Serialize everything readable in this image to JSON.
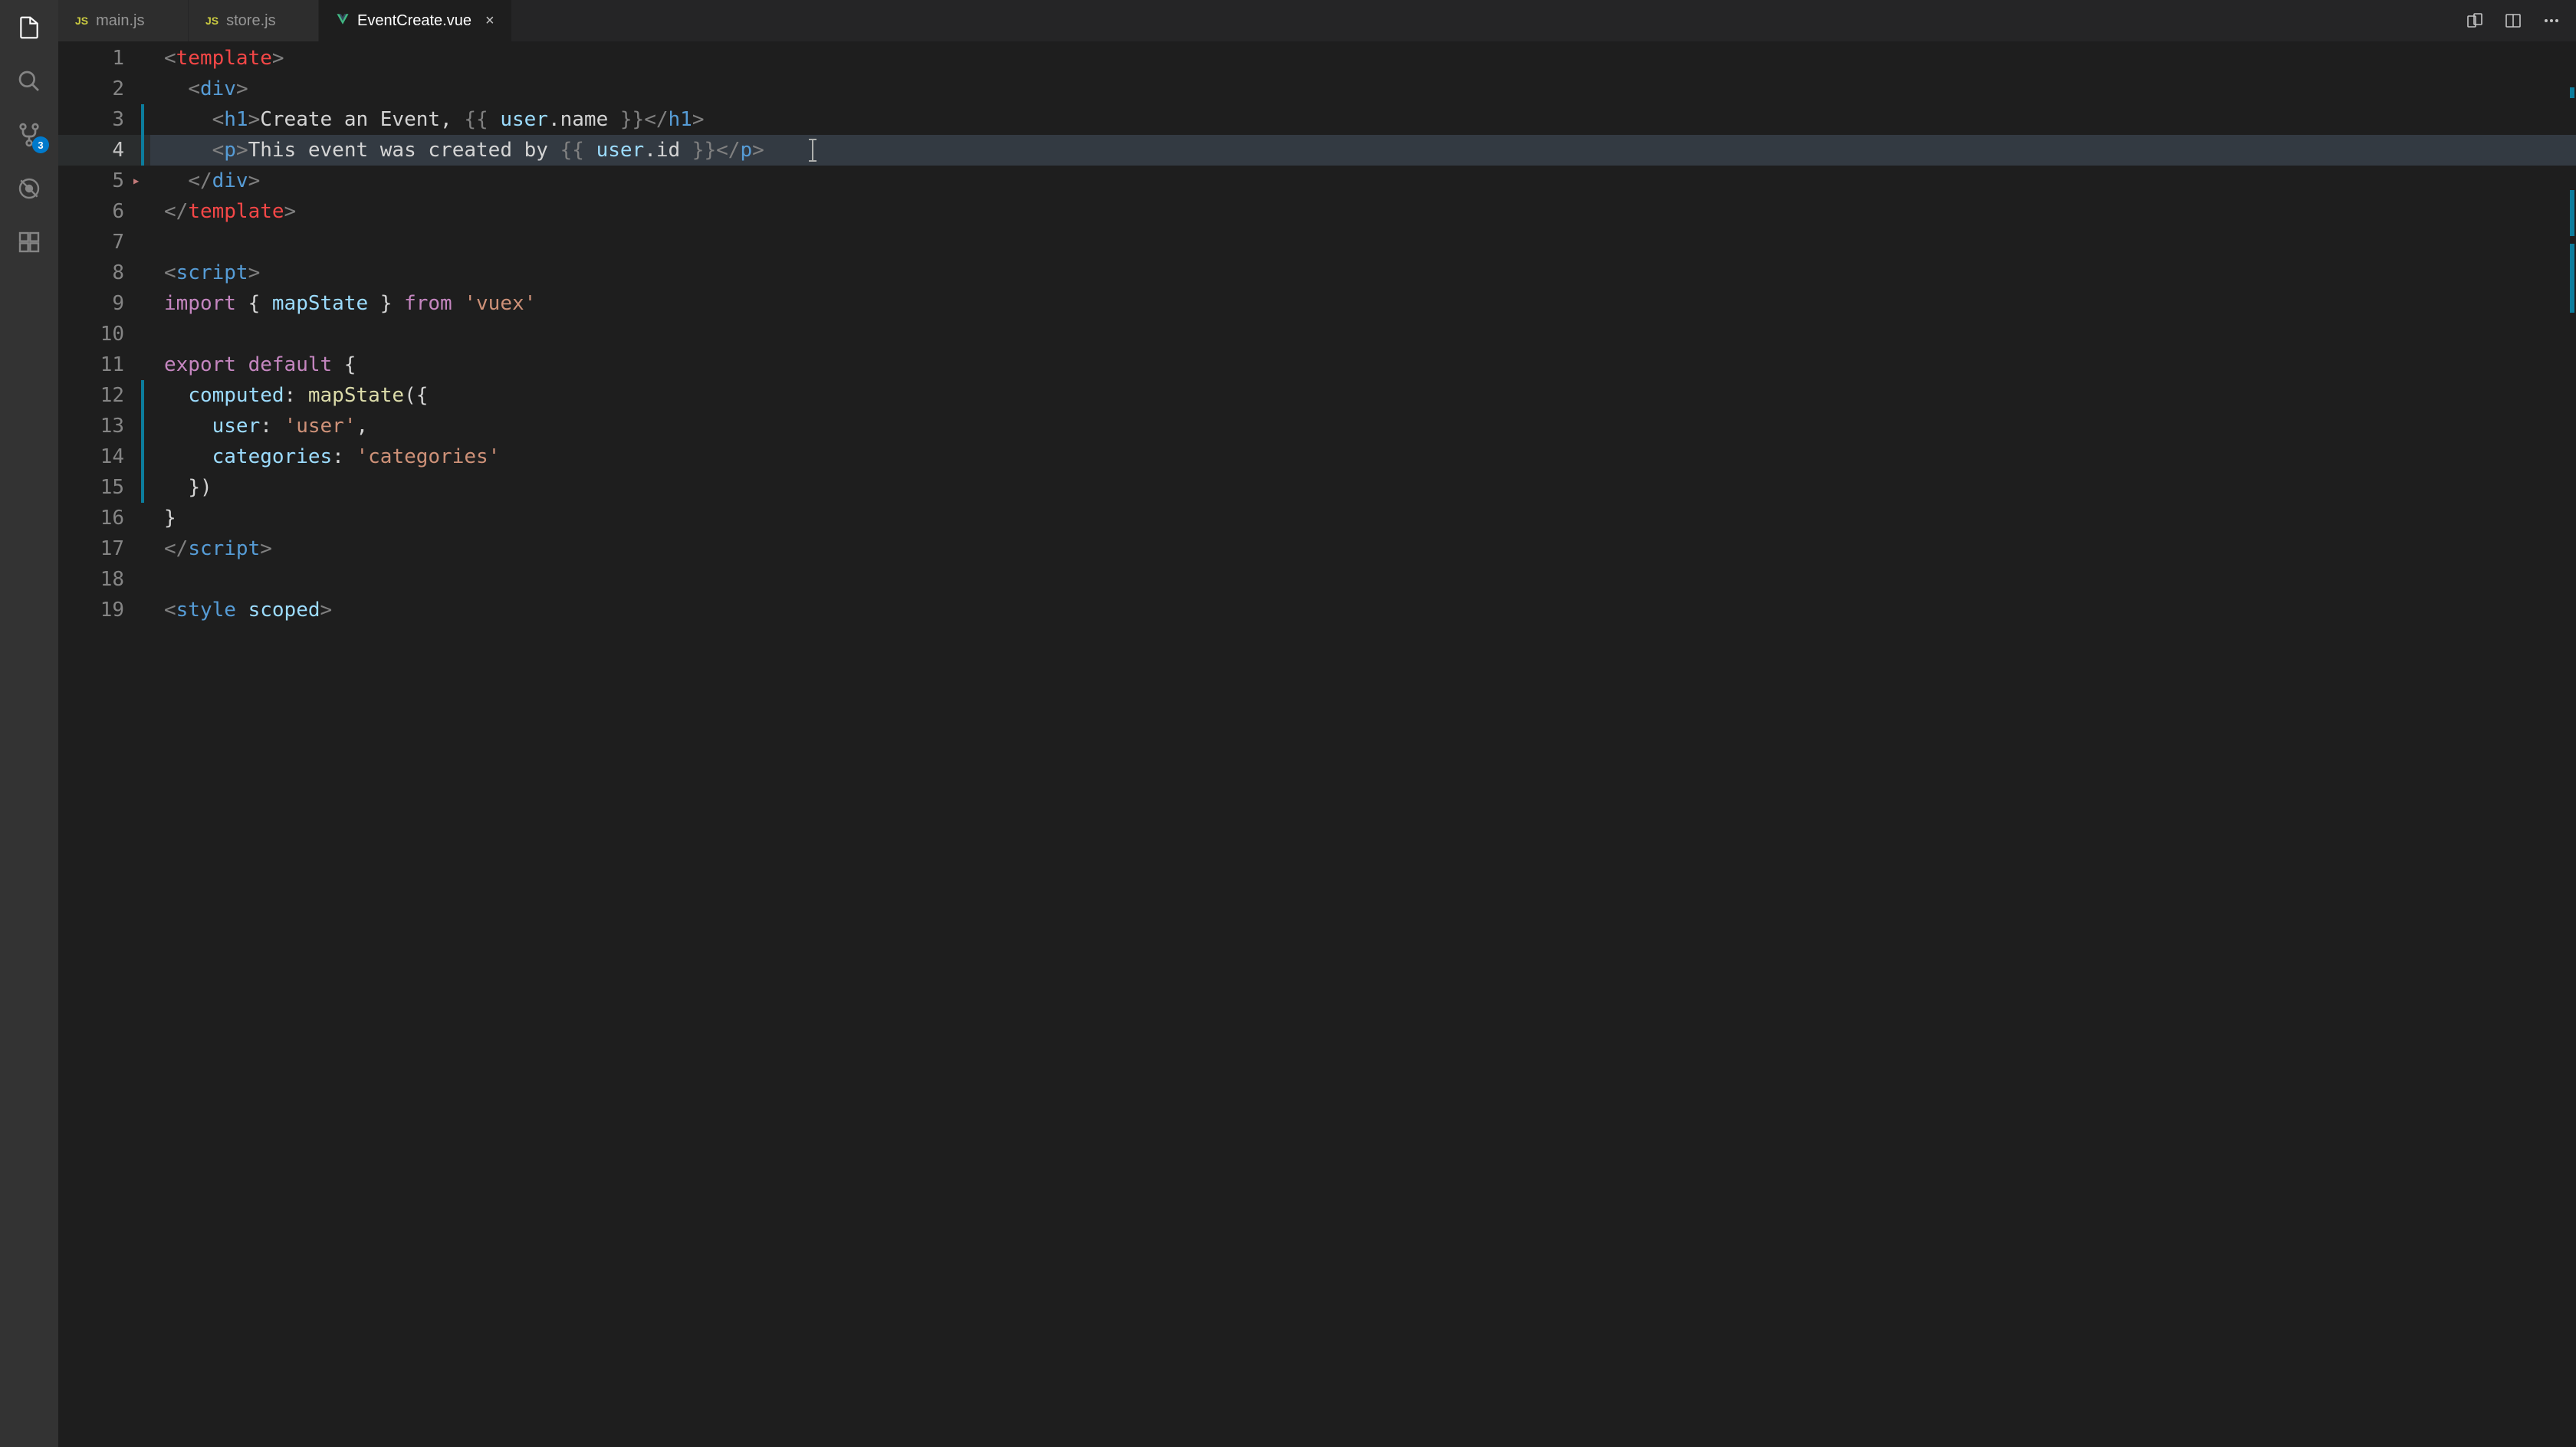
{
  "activityBar": {
    "explorerIcon": "files-icon",
    "searchIcon": "search-icon",
    "scmIcon": "source-control-icon",
    "scmBadge": "3",
    "debugIcon": "debug-icon",
    "extensionsIcon": "extensions-icon"
  },
  "tabs": [
    {
      "label": "main.js",
      "type": "js",
      "active": false
    },
    {
      "label": "store.js",
      "type": "js",
      "active": false
    },
    {
      "label": "EventCreate.vue",
      "type": "vue",
      "active": true,
      "closeShown": true
    }
  ],
  "editor": {
    "highlightedLine": 4,
    "modifiedRanges": [
      [
        3,
        4
      ],
      [
        12,
        15
      ]
    ],
    "lines": [
      {
        "n": 1,
        "tokens": [
          {
            "t": "<",
            "c": "c-punct"
          },
          {
            "t": "template",
            "c": "c-template-tag"
          },
          {
            "t": ">",
            "c": "c-punct"
          }
        ]
      },
      {
        "n": 2,
        "indent": 1,
        "tokens": [
          {
            "t": "<",
            "c": "c-punct"
          },
          {
            "t": "div",
            "c": "c-tag"
          },
          {
            "t": ">",
            "c": "c-punct"
          }
        ]
      },
      {
        "n": 3,
        "indent": 2,
        "tokens": [
          {
            "t": "<",
            "c": "c-punct"
          },
          {
            "t": "h1",
            "c": "c-tag"
          },
          {
            "t": ">",
            "c": "c-punct"
          },
          {
            "t": "Create an Event, ",
            "c": "c-text"
          },
          {
            "t": "{{ ",
            "c": "c-punct"
          },
          {
            "t": "user",
            "c": "c-var"
          },
          {
            "t": ".name",
            "c": "c-text"
          },
          {
            "t": " }}",
            "c": "c-punct"
          },
          {
            "t": "</",
            "c": "c-punct"
          },
          {
            "t": "h1",
            "c": "c-tag"
          },
          {
            "t": ">",
            "c": "c-punct"
          }
        ]
      },
      {
        "n": 4,
        "indent": 2,
        "highlighted": true,
        "cursorAfter": true,
        "tokens": [
          {
            "t": "<",
            "c": "c-punct"
          },
          {
            "t": "p",
            "c": "c-tag"
          },
          {
            "t": ">",
            "c": "c-punct"
          },
          {
            "t": "This event was created by ",
            "c": "c-text"
          },
          {
            "t": "{{ ",
            "c": "c-punct"
          },
          {
            "t": "user",
            "c": "c-var"
          },
          {
            "t": ".id",
            "c": "c-text"
          },
          {
            "t": " }}",
            "c": "c-punct"
          },
          {
            "t": "</",
            "c": "c-punct"
          },
          {
            "t": "p",
            "c": "c-tag"
          },
          {
            "t": ">",
            "c": "c-punct"
          }
        ]
      },
      {
        "n": 5,
        "indent": 1,
        "foldArrow": true,
        "tokens": [
          {
            "t": "</",
            "c": "c-punct"
          },
          {
            "t": "div",
            "c": "c-tag"
          },
          {
            "t": ">",
            "c": "c-punct"
          }
        ]
      },
      {
        "n": 6,
        "tokens": [
          {
            "t": "</",
            "c": "c-punct"
          },
          {
            "t": "template",
            "c": "c-template-tag"
          },
          {
            "t": ">",
            "c": "c-punct"
          }
        ]
      },
      {
        "n": 7,
        "tokens": []
      },
      {
        "n": 8,
        "tokens": [
          {
            "t": "<",
            "c": "c-punct"
          },
          {
            "t": "script",
            "c": "c-tag"
          },
          {
            "t": ">",
            "c": "c-punct"
          }
        ]
      },
      {
        "n": 9,
        "tokens": [
          {
            "t": "import",
            "c": "c-kw"
          },
          {
            "t": " { ",
            "c": "c-text"
          },
          {
            "t": "mapState",
            "c": "c-var"
          },
          {
            "t": " } ",
            "c": "c-text"
          },
          {
            "t": "from",
            "c": "c-kw"
          },
          {
            "t": " ",
            "c": "c-text"
          },
          {
            "t": "'vuex'",
            "c": "c-str"
          }
        ]
      },
      {
        "n": 10,
        "tokens": []
      },
      {
        "n": 11,
        "tokens": [
          {
            "t": "export",
            "c": "c-kw"
          },
          {
            "t": " ",
            "c": "c-text"
          },
          {
            "t": "default",
            "c": "c-kw"
          },
          {
            "t": " {",
            "c": "c-text"
          }
        ]
      },
      {
        "n": 12,
        "indent": 1,
        "tokens": [
          {
            "t": "computed",
            "c": "c-var"
          },
          {
            "t": ": ",
            "c": "c-text"
          },
          {
            "t": "mapState",
            "c": "c-func"
          },
          {
            "t": "({",
            "c": "c-text"
          }
        ]
      },
      {
        "n": 13,
        "indent": 2,
        "tokens": [
          {
            "t": "user",
            "c": "c-var"
          },
          {
            "t": ": ",
            "c": "c-text"
          },
          {
            "t": "'user'",
            "c": "c-str"
          },
          {
            "t": ",",
            "c": "c-text"
          }
        ]
      },
      {
        "n": 14,
        "indent": 2,
        "tokens": [
          {
            "t": "categories",
            "c": "c-var"
          },
          {
            "t": ": ",
            "c": "c-text"
          },
          {
            "t": "'categories'",
            "c": "c-str"
          }
        ]
      },
      {
        "n": 15,
        "indent": 1,
        "tokens": [
          {
            "t": "})",
            "c": "c-text"
          }
        ]
      },
      {
        "n": 16,
        "tokens": [
          {
            "t": "}",
            "c": "c-text"
          }
        ]
      },
      {
        "n": 17,
        "tokens": [
          {
            "t": "</",
            "c": "c-punct"
          },
          {
            "t": "script",
            "c": "c-tag"
          },
          {
            "t": ">",
            "c": "c-punct"
          }
        ]
      },
      {
        "n": 18,
        "tokens": []
      },
      {
        "n": 19,
        "tokens": [
          {
            "t": "<",
            "c": "c-punct"
          },
          {
            "t": "style",
            "c": "c-tag"
          },
          {
            "t": " ",
            "c": "c-text"
          },
          {
            "t": "scoped",
            "c": "c-attr"
          },
          {
            "t": ">",
            "c": "c-punct"
          }
        ]
      }
    ]
  }
}
